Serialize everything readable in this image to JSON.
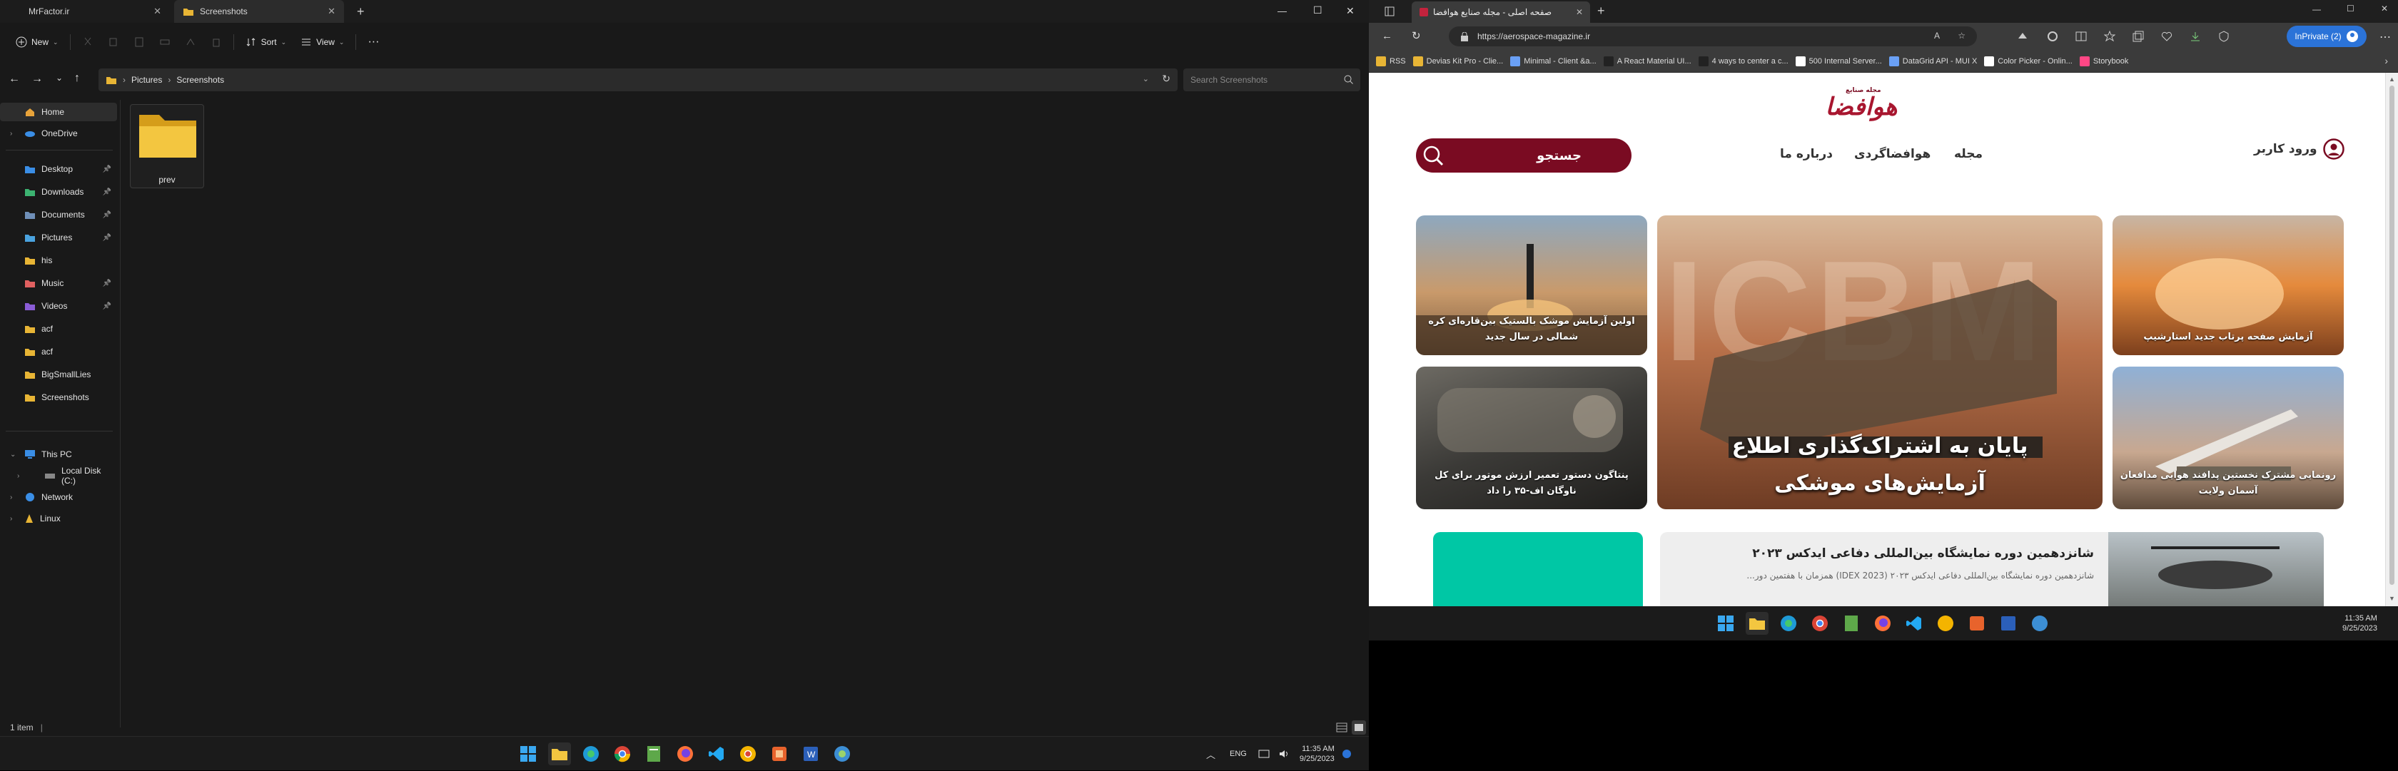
{
  "explorer": {
    "tabs": [
      {
        "label": "MrFactor.ir",
        "close": "✕"
      },
      {
        "label": "Screenshots",
        "close": "✕"
      }
    ],
    "new_tab": "+",
    "window_controls": {
      "minimize": "—",
      "maximize": "☐",
      "close": "✕"
    },
    "toolbar": {
      "new_label": "New",
      "sort_label": "Sort",
      "view_label": "View",
      "more": "···"
    },
    "breadcrumb": [
      "Pictures",
      "Screenshots"
    ],
    "breadcrumb_sep": "›",
    "search_placeholder": "Search Screenshots",
    "nav": {
      "home": "Home",
      "onedrive": "OneDrive",
      "quick": [
        {
          "label": "Desktop",
          "pinned": true,
          "color": "#3a8ee6"
        },
        {
          "label": "Downloads",
          "pinned": true,
          "color": "#3cb371"
        },
        {
          "label": "Documents",
          "pinned": true,
          "color": "#6f8fb8"
        },
        {
          "label": "Pictures",
          "pinned": true,
          "color": "#4aa3df"
        },
        {
          "label": "his",
          "pinned": false,
          "color": "#e8b535"
        },
        {
          "label": "Music",
          "pinned": true,
          "color": "#e06060"
        },
        {
          "label": "Videos",
          "pinned": true,
          "color": "#8a5cd6"
        },
        {
          "label": "acf",
          "pinned": false,
          "color": "#e8b535"
        },
        {
          "label": "acf",
          "pinned": false,
          "color": "#e8b535"
        },
        {
          "label": "BigSmallLies",
          "pinned": false,
          "color": "#e8b535"
        },
        {
          "label": "Screenshots",
          "pinned": false,
          "color": "#e8b535"
        }
      ],
      "this_pc": "This PC",
      "local_disk": "Local Disk (C:)",
      "network": "Network",
      "linux": "Linux"
    },
    "folder_item": {
      "label": "prev"
    },
    "status": "1 item",
    "status_sep": "|"
  },
  "taskbar_left": {
    "time": "11:35 AM",
    "date": "9/25/2023",
    "lang": "ENG",
    "chevron": "︿"
  },
  "browser": {
    "tab_title": "صفحه اصلی - مجله صنایع هوافضا",
    "tab_close": "✕",
    "new_tab": "+",
    "url": "https://aerospace-magazine.ir",
    "inprivate_label": "InPrivate (2)",
    "favorites": [
      {
        "label": "RSS",
        "color": "#e8b535"
      },
      {
        "label": "Devias Kit Pro - Clie...",
        "color": "#e8b535"
      },
      {
        "label": "Minimal - Client &a...",
        "color": "#6aa0f5"
      },
      {
        "label": "A React Material UI...",
        "color": "#222222"
      },
      {
        "label": "4 ways to center a c...",
        "color": "#222222"
      },
      {
        "label": "500 Internal Server...",
        "color": "#ffffff"
      },
      {
        "label": "DataGrid API - MUI X",
        "color": "#6aa0f5"
      },
      {
        "label": "Color Picker - Onlin...",
        "color": "#ffffff"
      },
      {
        "label": "Storybook",
        "color": "#ff4785"
      }
    ],
    "fav_more": "›",
    "site": {
      "logo_small": "مجله صنایع",
      "logo_main": "هوافضا",
      "login": "ورود کاربر",
      "menu": [
        "مجله",
        "هوافضاگردی",
        "درباره ما"
      ],
      "search_label": "جستجو",
      "cards": {
        "left_top": "اولین آزمایش موشک بالستیک بین‌قاره‌ای کره شمالی در سال جدید",
        "left_bottom": "پنتاگون دستور تعمیر ارزش موتور برای کل ناوگان اف-۳۵ را داد",
        "center_bg_text": "ICBM",
        "center": "پایان به اشتراک‌گذاری اطلاع آزمایش‌های موشکی",
        "right_top": "آزمایش صفحه پرتاب جدید استارشیپ",
        "right_bottom": "رونمایی مشترک نخستین پدافند هوایی مدافعان آسمان ولایت"
      },
      "article": {
        "title": "شانزدهمین دوره نمایشگاه بین‌المللی دفاعی ایدکس ۲۰۲۳",
        "excerpt": "شانزدهمین دوره نمایشگاه بین‌المللی دفاعی ایدکس ۲۰۲۳ (IDEX 2023) همزمان با هفتمین دور..."
      }
    }
  },
  "taskbar_right": {
    "time": "11:35 AM",
    "date": "9/25/2023"
  },
  "colors": {
    "accent_red": "#7a0b22",
    "inprivate_blue": "#2b73d8",
    "teal": "#00c7a5"
  }
}
